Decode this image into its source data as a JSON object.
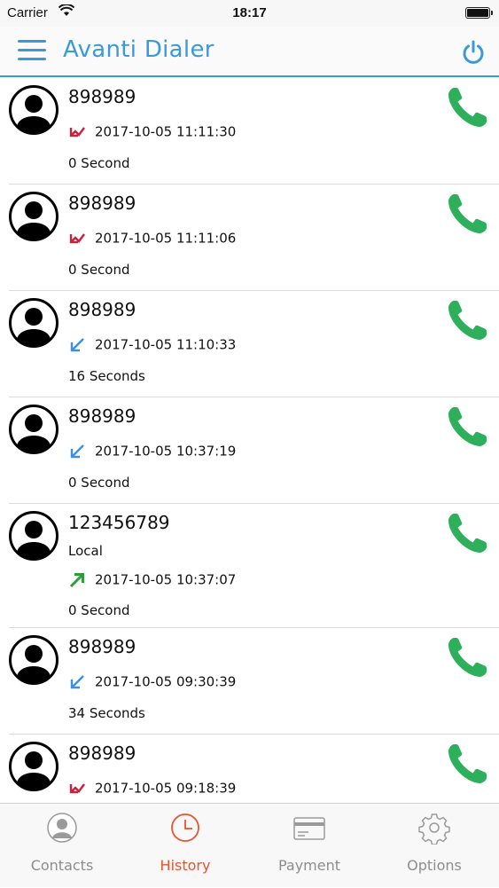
{
  "status_bar": {
    "carrier": "Carrier",
    "time": "18:17"
  },
  "header": {
    "title": "Avanti Dialer",
    "menu_icon": "hamburger-menu-icon",
    "power_icon": "power-icon"
  },
  "colors": {
    "accent": "#3a9ad9",
    "call_green": "#2eaf5b",
    "missed_red": "#c8233e",
    "incoming_blue": "#3f8fdc",
    "outgoing_green": "#2e9c3a",
    "tab_active": "#e8542f"
  },
  "calls": [
    {
      "number": "898989",
      "label": "",
      "direction": "missed",
      "datetime": "2017-10-05 11:11:30",
      "duration": "0 Second"
    },
    {
      "number": "898989",
      "label": "",
      "direction": "missed",
      "datetime": "2017-10-05 11:11:06",
      "duration": "0 Second"
    },
    {
      "number": "898989",
      "label": "",
      "direction": "incoming",
      "datetime": "2017-10-05 11:10:33",
      "duration": "16 Seconds"
    },
    {
      "number": "898989",
      "label": "",
      "direction": "incoming",
      "datetime": "2017-10-05 10:37:19",
      "duration": "0 Second"
    },
    {
      "number": "123456789",
      "label": "Local",
      "direction": "outgoing",
      "datetime": "2017-10-05 10:37:07",
      "duration": "0 Second"
    },
    {
      "number": "898989",
      "label": "",
      "direction": "incoming",
      "datetime": "2017-10-05 09:30:39",
      "duration": "34 Seconds"
    },
    {
      "number": "898989",
      "label": "",
      "direction": "missed",
      "datetime": "2017-10-05 09:18:39",
      "duration": ""
    }
  ],
  "tabs": [
    {
      "label": "Contacts",
      "icon": "contacts-icon",
      "active": false
    },
    {
      "label": "History",
      "icon": "clock-icon",
      "active": true
    },
    {
      "label": "Payment",
      "icon": "credit-card-icon",
      "active": false
    },
    {
      "label": "Options",
      "icon": "gear-icon",
      "active": false
    }
  ]
}
